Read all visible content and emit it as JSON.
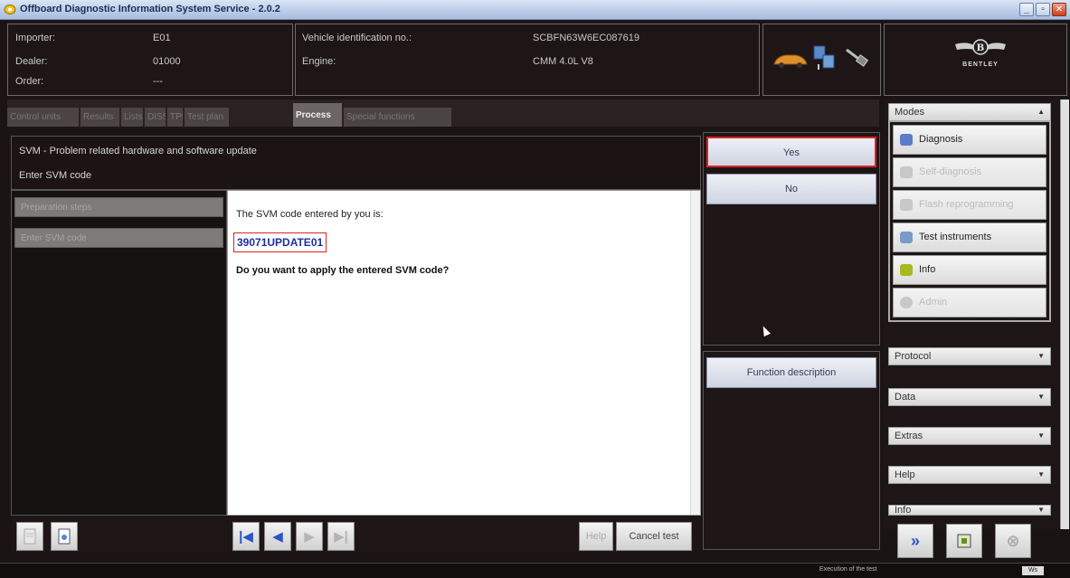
{
  "window": {
    "title": "Offboard Diagnostic Information System Service - 2.0.2",
    "controls": [
      "_",
      "▫",
      "✕"
    ]
  },
  "info": {
    "importer_label": "Importer:",
    "importer_value": "E01",
    "dealer_label": "Dealer:",
    "dealer_value": "01000",
    "order_label": "Order:",
    "order_value": "---",
    "vin_label": "Vehicle identification no.:",
    "vin_value": "SCBFN63W6EC087619",
    "engine_label": "Engine:",
    "engine_value": "CMM 4.0L V8"
  },
  "brand": {
    "name": "BENTLEY",
    "emblem": "B"
  },
  "tabs": [
    {
      "label": "Control units"
    },
    {
      "label": "Results"
    },
    {
      "label": "Lists"
    },
    {
      "label": "DISS"
    },
    {
      "label": "TPL"
    },
    {
      "label": "Test plan"
    },
    {
      "label": "Process",
      "active": true
    },
    {
      "label": "Special functions"
    }
  ],
  "procedure": {
    "title": "SVM - Problem related hardware and software update",
    "subtitle": "Enter SVM code"
  },
  "steps": [
    {
      "label": "Preparation steps"
    },
    {
      "label": "Enter SVM code"
    }
  ],
  "content": {
    "message": "The SVM code entered by you is:",
    "code": "39071UPDATE01",
    "question": "Do you want to apply the entered SVM code?"
  },
  "options": {
    "yes": "Yes",
    "no": "No",
    "function_description": "Function description"
  },
  "toolbar": {
    "first": "|◀",
    "prev": "◀",
    "next": "▶",
    "last": "▶|",
    "help": "Help",
    "cancel": "Cancel test"
  },
  "sidebar": {
    "modes_label": "Modes",
    "modes": [
      {
        "label": "Diagnosis",
        "enabled": true,
        "icon": "diagnosis-icon",
        "color": "#5b7cc8"
      },
      {
        "label": "Self-diagnosis",
        "enabled": false,
        "icon": "self-diagnosis-icon",
        "color": "#c8c8c8"
      },
      {
        "label": "Flash reprogramming",
        "enabled": false,
        "icon": "flash-icon",
        "color": "#c8c8c8"
      },
      {
        "label": "Test instruments",
        "enabled": true,
        "icon": "test-instruments-icon",
        "color": "#7a9ac8"
      },
      {
        "label": "Info",
        "enabled": true,
        "icon": "info-icon",
        "color": "#a8b820"
      },
      {
        "label": "Admin",
        "enabled": false,
        "icon": "admin-icon",
        "color": "#c8c8c8"
      }
    ],
    "sections": [
      {
        "label": "Protocol"
      },
      {
        "label": "Data"
      },
      {
        "label": "Extras"
      },
      {
        "label": "Help"
      },
      {
        "label": "Info"
      }
    ]
  },
  "status": {
    "text": "Execution of the test",
    "badge": "Ws"
  },
  "colors": {
    "accent_red": "#dd2222",
    "code_blue": "#1b2fa0",
    "nav_blue": "#2a55c8"
  }
}
